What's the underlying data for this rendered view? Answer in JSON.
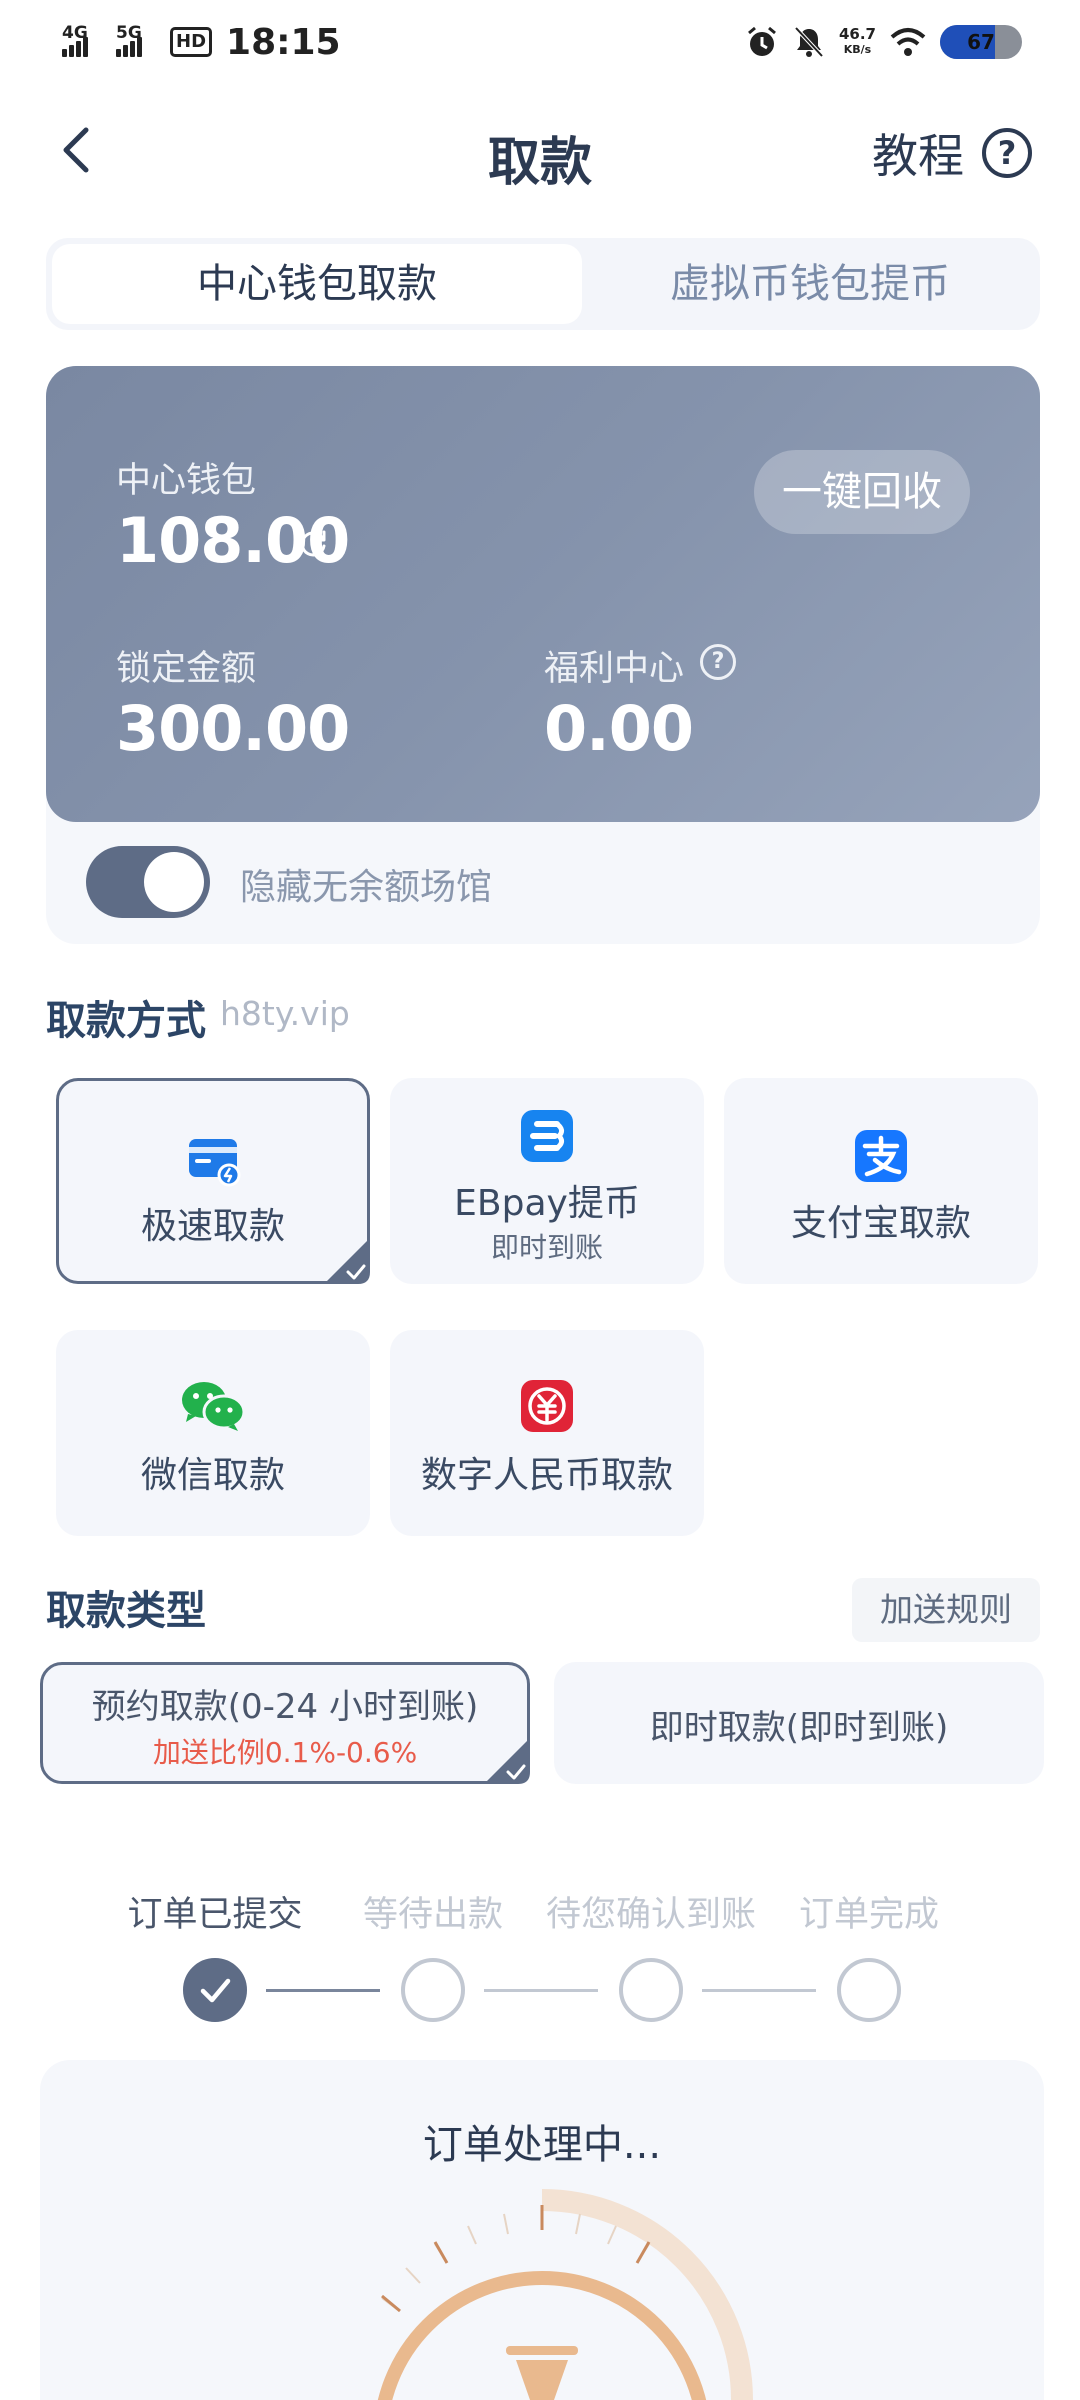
{
  "status_bar": {
    "net1": "4G",
    "net2": "5G",
    "hd": "HD",
    "time": "18:15",
    "speed_value": "46.7",
    "speed_unit": "KB/s",
    "battery": "67"
  },
  "header": {
    "title": "取款",
    "tutorial_label": "教程",
    "help_symbol": "?"
  },
  "tabs": [
    {
      "label": "中心钱包取款",
      "active": true
    },
    {
      "label": "虚拟币钱包提币",
      "active": false
    }
  ],
  "wallet": {
    "center_label": "中心钱包",
    "center_amount": "108.00",
    "recycle_button": "一键回收",
    "locked_label": "锁定金额",
    "locked_amount": "300.00",
    "welfare_label": "福利中心",
    "welfare_info": "?",
    "welfare_amount": "0.00",
    "hide_empty_label": "隐藏无余额场馆",
    "hide_empty_on": true
  },
  "methods_section": {
    "title": "取款方式",
    "subtitle": "h8ty.vip"
  },
  "methods": [
    {
      "label": "极速取款",
      "sub": "",
      "icon": "card-icon",
      "selected": true
    },
    {
      "label": "EBpay提币",
      "sub": "即时到账",
      "icon": "ebpay-icon",
      "selected": false
    },
    {
      "label": "支付宝取款",
      "sub": "",
      "icon": "alipay-icon",
      "selected": false
    },
    {
      "label": "微信取款",
      "sub": "",
      "icon": "wechat-icon",
      "selected": false
    },
    {
      "label": "数字人民币取款",
      "sub": "",
      "icon": "ecny-icon",
      "selected": false
    }
  ],
  "type_section": {
    "title": "取款类型",
    "rules_button": "加送规则"
  },
  "types": [
    {
      "label": "预约取款(0-24 小时到账)",
      "note": "加送比例0.1%-0.6%",
      "selected": true
    },
    {
      "label": "即时取款(即时到账)",
      "note": "",
      "selected": false
    }
  ],
  "steps": [
    {
      "label": "订单已提交",
      "done": true
    },
    {
      "label": "等待出款",
      "done": false
    },
    {
      "label": "待您确认到账",
      "done": false
    },
    {
      "label": "订单完成",
      "done": false
    }
  ],
  "processing": {
    "title": "订单处理中..."
  },
  "colors": {
    "primary_dark": "#2c3a52",
    "slate": "#5e6c86",
    "card_bg": "#f4f6fb",
    "accent_red": "#e85b4a",
    "dial_orange": "#e9b98e",
    "alipay_blue": "#1677ff",
    "wechat_green": "#22b14c",
    "ecny_red": "#e02437"
  }
}
